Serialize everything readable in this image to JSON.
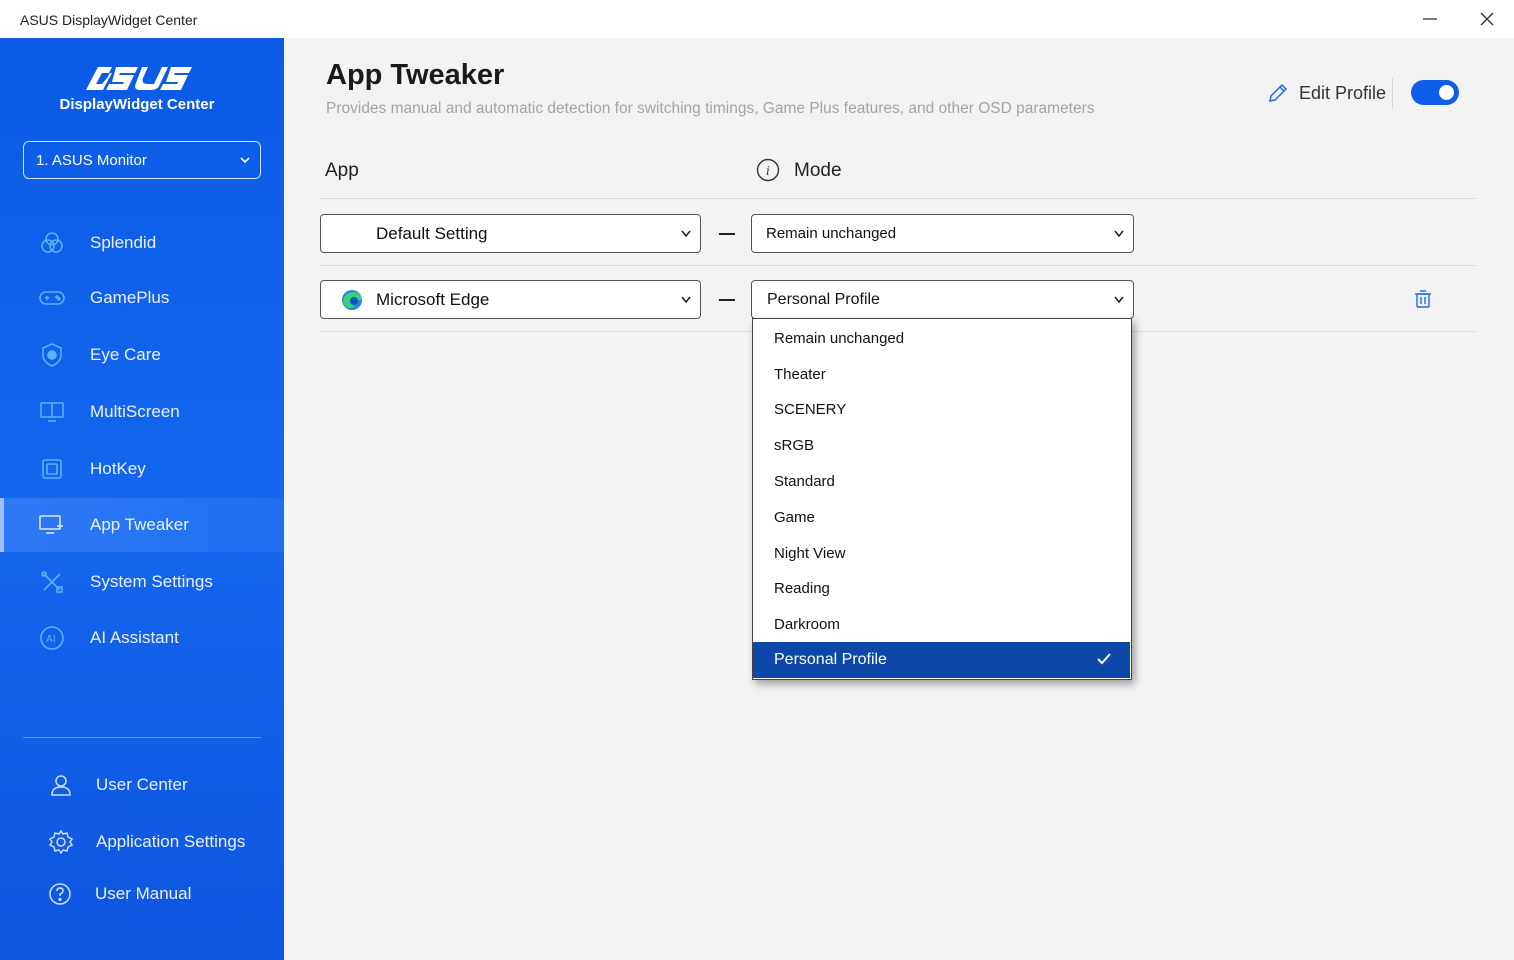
{
  "window": {
    "title": "ASUS DisplayWidget Center"
  },
  "sidebar": {
    "brand_name": "DisplayWidget Center",
    "monitor_select": "1. ASUS Monitor",
    "nav": [
      {
        "label": "Splendid",
        "icon": "splendid-icon"
      },
      {
        "label": "GamePlus",
        "icon": "gamepad-icon"
      },
      {
        "label": "Eye Care",
        "icon": "eye-care-icon"
      },
      {
        "label": "MultiScreen",
        "icon": "multiscreen-icon"
      },
      {
        "label": "HotKey",
        "icon": "hotkey-icon"
      },
      {
        "label": "App Tweaker",
        "icon": "app-tweaker-icon",
        "active": true
      },
      {
        "label": "System Settings",
        "icon": "tools-icon"
      },
      {
        "label": "AI Assistant",
        "icon": "ai-icon"
      }
    ],
    "footer": [
      {
        "label": "User Center",
        "icon": "user-icon"
      },
      {
        "label": "Application Settings",
        "icon": "gear-icon"
      },
      {
        "label": "User Manual",
        "icon": "help-icon"
      }
    ],
    "colors": {
      "top": "#0a5ae6",
      "active": "#2f79f5"
    }
  },
  "main": {
    "title": "App Tweaker",
    "subtitle": "Provides manual and automatic detection for switching timings, Game Plus features, and other OSD parameters",
    "edit_profile_label": "Edit Profile",
    "toggle_on": true,
    "col_app": "App",
    "col_mode": "Mode",
    "rows": [
      {
        "app": "Default Setting",
        "mode": "Remain unchanged"
      },
      {
        "app": "Microsoft Edge",
        "app_icon": "edge-icon",
        "mode": "Personal Profile"
      }
    ],
    "mode_options": [
      "Remain unchanged",
      "Theater",
      "SCENERY",
      "sRGB",
      "Standard",
      "Game",
      "Night View",
      "Reading",
      "Darkroom",
      "Personal Profile"
    ],
    "selected_mode": "Personal Profile",
    "accent": "#0d5de8",
    "selected_bg": "#0d47a8"
  }
}
